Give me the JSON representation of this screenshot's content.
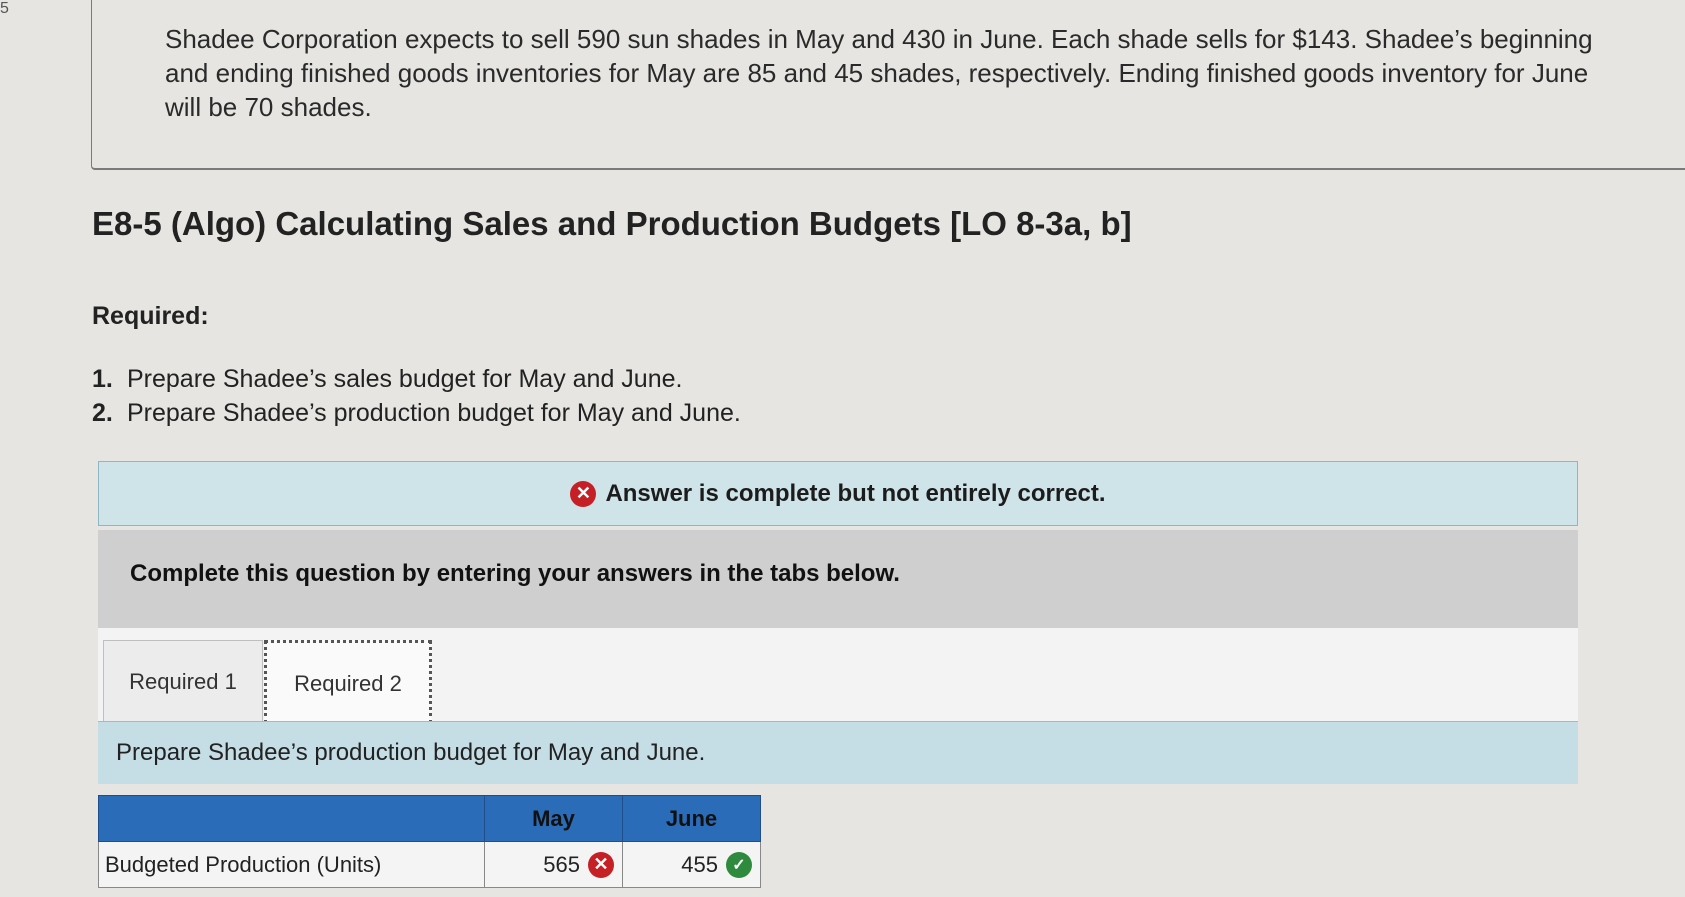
{
  "edge_marker": "5",
  "intro": "Shadee Corporation expects to sell 590 sun shades in May and 430 in June. Each shade sells for $143. Shadee’s beginning and ending finished goods inventories for May are 85 and 45 shades, respectively. Ending finished goods inventory for June will be 70 shades.",
  "title": "E8-5 (Algo) Calculating Sales and Production Budgets [LO 8-3a, b]",
  "required_heading": "Required:",
  "required_items": [
    {
      "num": "1.",
      "text": "Prepare Shadee’s sales budget for May and June."
    },
    {
      "num": "2.",
      "text": "Prepare Shadee’s production budget for May and June."
    }
  ],
  "banner": {
    "icon": "x-icon",
    "text": "Answer is complete but not entirely correct."
  },
  "instructions": "Complete this question by entering your answers in the tabs below.",
  "tabs": [
    {
      "label": "Required 1",
      "active": false
    },
    {
      "label": "Required 2",
      "active": true
    }
  ],
  "prompt": "Prepare Shadee’s production budget for May and June.",
  "table": {
    "headers": [
      "",
      "May",
      "June"
    ],
    "row": {
      "label": "Budgeted Production (Units)",
      "may": {
        "value": "565",
        "status": "incorrect"
      },
      "june": {
        "value": "455",
        "status": "correct"
      }
    }
  },
  "colors": {
    "error": "#c42026",
    "success": "#2e8b3e",
    "header_blue": "#2b6cb8",
    "banner_bg": "#cfe4e9"
  }
}
